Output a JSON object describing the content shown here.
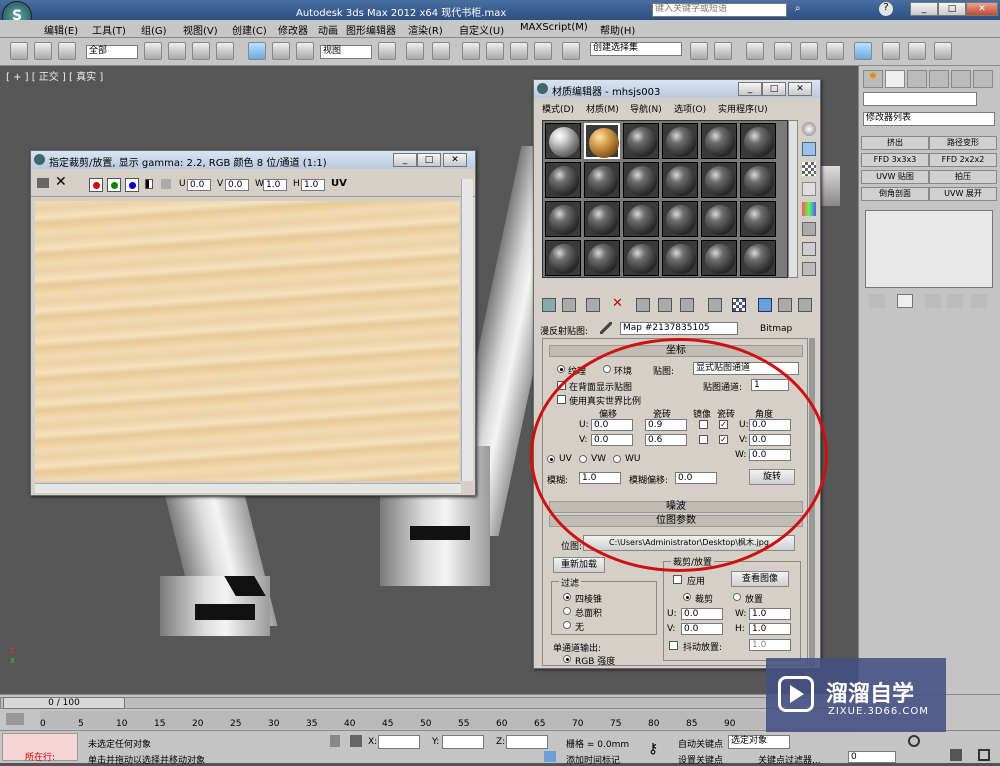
{
  "app": {
    "title": "Autodesk 3ds Max  2012 x64     现代书柜.max",
    "search_placeholder": "键入关键字或短语"
  },
  "menu": [
    "编辑(E)",
    "工具(T)",
    "组(G)",
    "视图(V)",
    "创建(C)",
    "修改器",
    "动画",
    "图形编辑器",
    "渲染(R)",
    "自定义(U)",
    "MAXScript(M)",
    "帮助(H)"
  ],
  "toolbar": {
    "selection_filter": "全部",
    "coord": "视图",
    "named_sel": "创建选择集"
  },
  "viewport": {
    "label": "[ + ] [ 正交 ] [ 真实 ]"
  },
  "frame_window": {
    "title": "指定裁剪/放置, 显示 gamma: 2.2, RGB 颜色 8 位/通道 (1:1)",
    "u_label": "U",
    "u": "0.0",
    "v_label": "V",
    "v": "0.0",
    "w_label": "W",
    "w": "1.0",
    "h_label": "H",
    "h": "1.0",
    "uv": "UV"
  },
  "mat_editor": {
    "title": "材质编辑器 - mhsjs003",
    "menu": [
      "模式(D)",
      "材质(M)",
      "导航(N)",
      "选项(O)",
      "实用程序(U)"
    ],
    "map_label": "漫反射贴图:",
    "map_name": "Map #2137835105",
    "map_type": "Bitmap",
    "coords": {
      "header": "坐标",
      "texture": "纹理",
      "environ": "环境",
      "mapping_label": "贴图:",
      "mapping": "显式贴图通道",
      "show_back": "在背面显示贴图",
      "channel_label": "贴图通道:",
      "channel": "1",
      "real_world": "使用真实世界比例",
      "offset": "偏移",
      "tiling": "瓷砖",
      "mirror": "镜像",
      "tile": "瓷砖",
      "angle": "角度",
      "u_label": "U:",
      "v_label": "V:",
      "w_label": "W:",
      "u_offset": "0.0",
      "v_offset": "0.0",
      "u_tiling": "0.9",
      "v_tiling": "0.6",
      "u_angle": "0.0",
      "v_angle": "0.0",
      "w_angle": "0.0",
      "uv": "UV",
      "vw": "VW",
      "wu": "WU",
      "blur_label": "模糊:",
      "blur": "1.0",
      "blur_offset_label": "模糊偏移:",
      "blur_offset": "0.0",
      "rotate": "旋转"
    },
    "noise": "噪波",
    "bitmap_params": {
      "header": "位图参数",
      "bitmap_label": "位图:",
      "path": "C:\\Users\\Administrator\\Desktop\\枫木.jpg",
      "reload": "重新加载",
      "crop_header": "裁剪/放置",
      "apply": "应用",
      "view_image": "查看图像",
      "crop": "裁剪",
      "place": "放置",
      "u_label": "U:",
      "v_label": "V:",
      "w_label": "W:",
      "h_label": "H:",
      "u": "0.0",
      "v": "0.0",
      "w": "1.0",
      "h": "1.0",
      "jitter": "抖动放置:",
      "jitter_val": "1.0",
      "filter": "过滤",
      "pyramidal": "四棱锥",
      "summed": "总面积",
      "none": "无",
      "mono_out": "单通道输出:",
      "rgb_intensity": "RGB 强度"
    }
  },
  "cmd_panel": {
    "modifier_list": "修改器列表",
    "buttons": [
      "挤出",
      "路径变形",
      "FFD 3x3x3",
      "FFD 2x2x2",
      "UVW 贴图",
      "拍压",
      "倒角剖面",
      "UVW 展开"
    ]
  },
  "timeline": {
    "frame": "0 / 100",
    "ticks": [
      "0",
      "5",
      "10",
      "15",
      "20",
      "25",
      "30",
      "35",
      "40",
      "45",
      "50",
      "55",
      "60",
      "65",
      "70",
      "75",
      "80",
      "85",
      "90"
    ]
  },
  "status": {
    "mode": "所在行:",
    "selection": "未选定任何对象",
    "prompt": "单击并拖动以选择并移动对象",
    "x_label": "X:",
    "y_label": "Y:",
    "z_label": "Z:",
    "grid": "栅格 = 0.0mm",
    "autokey": "自动关键点",
    "setkey": "设置关键点",
    "sel_obj": "选定对象",
    "add_time": "添加时间标记",
    "key_filter": "关键点过滤器...",
    "frame_val": "0"
  },
  "watermark": {
    "name": "溜溜自学",
    "url": "ZIXUE.3D66.COM"
  }
}
